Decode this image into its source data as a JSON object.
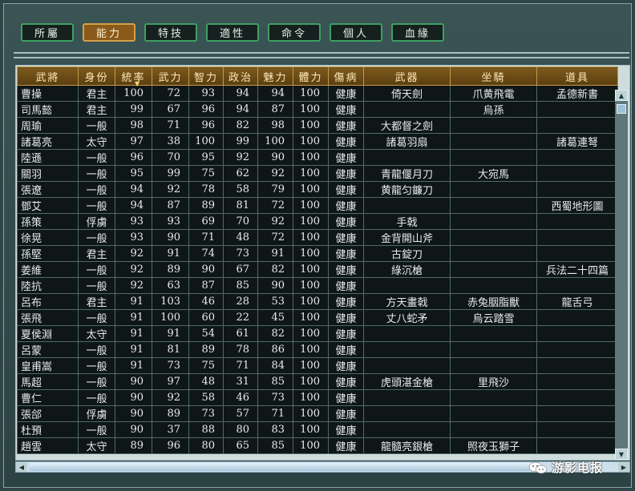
{
  "tabs": [
    {
      "label": "所屬",
      "active": false
    },
    {
      "label": "能力",
      "active": true
    },
    {
      "label": "特技",
      "active": false
    },
    {
      "label": "適性",
      "active": false
    },
    {
      "label": "命令",
      "active": false
    },
    {
      "label": "個人",
      "active": false
    },
    {
      "label": "血緣",
      "active": false
    }
  ],
  "table": {
    "sort_column": "統率",
    "headers": [
      "武將",
      "身份",
      "統率",
      "武力",
      "智力",
      "政治",
      "魅力",
      "體力",
      "傷病",
      "武器",
      "坐騎",
      "道具"
    ],
    "rows": [
      [
        "曹操",
        "君主",
        "100",
        "72",
        "93",
        "94",
        "94",
        "100",
        "健康",
        "倚天劍",
        "爪黄飛電",
        "孟德新書"
      ],
      [
        "司馬懿",
        "君主",
        "99",
        "67",
        "96",
        "94",
        "87",
        "100",
        "健康",
        "",
        "烏孫",
        ""
      ],
      [
        "周瑜",
        "一般",
        "98",
        "71",
        "96",
        "82",
        "98",
        "100",
        "健康",
        "大都督之劍",
        "",
        ""
      ],
      [
        "諸葛亮",
        "太守",
        "97",
        "38",
        "100",
        "99",
        "100",
        "100",
        "健康",
        "諸葛羽扇",
        "",
        "諸葛連弩"
      ],
      [
        "陸遜",
        "一般",
        "96",
        "70",
        "95",
        "92",
        "90",
        "100",
        "健康",
        "",
        "",
        ""
      ],
      [
        "關羽",
        "一般",
        "95",
        "99",
        "75",
        "62",
        "92",
        "100",
        "健康",
        "青龍偃月刀",
        "大宛馬",
        ""
      ],
      [
        "張遼",
        "一般",
        "94",
        "92",
        "78",
        "58",
        "79",
        "100",
        "健康",
        "黄龍匀鐮刀",
        "",
        ""
      ],
      [
        "鄧艾",
        "一般",
        "94",
        "87",
        "89",
        "81",
        "72",
        "100",
        "健康",
        "",
        "",
        "西蜀地形圖"
      ],
      [
        "孫策",
        "俘虜",
        "93",
        "93",
        "69",
        "70",
        "92",
        "100",
        "健康",
        "手戟",
        "",
        ""
      ],
      [
        "徐晃",
        "一般",
        "93",
        "90",
        "71",
        "48",
        "72",
        "100",
        "健康",
        "金背開山斧",
        "",
        ""
      ],
      [
        "孫堅",
        "君主",
        "92",
        "91",
        "74",
        "73",
        "91",
        "100",
        "健康",
        "古錠刀",
        "",
        ""
      ],
      [
        "姜維",
        "一般",
        "92",
        "89",
        "90",
        "67",
        "82",
        "100",
        "健康",
        "綠沉槍",
        "",
        "兵法二十四篇"
      ],
      [
        "陸抗",
        "一般",
        "92",
        "63",
        "87",
        "85",
        "90",
        "100",
        "健康",
        "",
        "",
        ""
      ],
      [
        "呂布",
        "君主",
        "91",
        "103",
        "46",
        "28",
        "53",
        "100",
        "健康",
        "方天畫戟",
        "赤兔胭脂獸",
        "龍舌弓"
      ],
      [
        "張飛",
        "一般",
        "91",
        "100",
        "60",
        "22",
        "45",
        "100",
        "健康",
        "丈八蛇矛",
        "烏云踏雪",
        ""
      ],
      [
        "夏侯淵",
        "太守",
        "91",
        "91",
        "54",
        "61",
        "82",
        "100",
        "健康",
        "",
        "",
        ""
      ],
      [
        "呂蒙",
        "一般",
        "91",
        "81",
        "89",
        "78",
        "86",
        "100",
        "健康",
        "",
        "",
        ""
      ],
      [
        "皇甫嵩",
        "一般",
        "91",
        "73",
        "75",
        "71",
        "84",
        "100",
        "健康",
        "",
        "",
        ""
      ],
      [
        "馬超",
        "一般",
        "90",
        "97",
        "48",
        "31",
        "85",
        "100",
        "健康",
        "虎頭湛金槍",
        "里飛沙",
        ""
      ],
      [
        "曹仁",
        "一般",
        "90",
        "92",
        "58",
        "46",
        "73",
        "100",
        "健康",
        "",
        "",
        ""
      ],
      [
        "張郃",
        "俘虜",
        "90",
        "89",
        "73",
        "57",
        "71",
        "100",
        "健康",
        "",
        "",
        ""
      ],
      [
        "杜預",
        "一般",
        "90",
        "37",
        "88",
        "80",
        "83",
        "100",
        "健康",
        "",
        "",
        ""
      ],
      [
        "趙雲",
        "太守",
        "89",
        "96",
        "80",
        "65",
        "85",
        "100",
        "健康",
        "龍髓亮銀槍",
        "照夜玉獅子",
        ""
      ]
    ]
  },
  "watermark": "游影电报",
  "icons": {
    "scroll_up": "triangle-up",
    "scroll_down": "triangle-down",
    "scroll_left": "triangle-left",
    "scroll_right": "triangle-right",
    "sort": "triangle-down"
  },
  "colors": {
    "header_bg": "#6b4a16",
    "header_text": "#ffe9b8",
    "cell_bg": "#0f1616",
    "tab_active": "#8a5a1c",
    "tab_border": "#3fa062"
  }
}
